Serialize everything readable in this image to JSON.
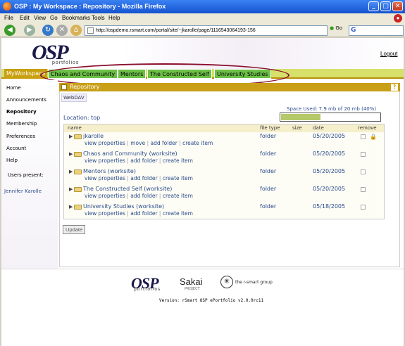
{
  "window": {
    "title": "OSP : My Workspace : Repository - Mozilla Firefox"
  },
  "menu": [
    "File",
    "Edit",
    "View",
    "Go",
    "Bookmarks",
    "Tools",
    "Help"
  ],
  "nav": {
    "url": "http://ospdemo.rsmart.com/portal/site/~jkarolle/page/1116543064193-156",
    "go_label": "Go",
    "search_value": ""
  },
  "header": {
    "logo": "OSP",
    "logo_sub": "portfolios",
    "logout": "Logout"
  },
  "tabs": [
    {
      "label": "MyWorkspace"
    },
    {
      "label": "Chaos and Community"
    },
    {
      "label": "Mentors"
    },
    {
      "label": "The Constructed Self"
    },
    {
      "label": "University Studies"
    }
  ],
  "sidebar": {
    "items": [
      {
        "label": "Home"
      },
      {
        "label": "Announcements"
      },
      {
        "label": "Repository"
      },
      {
        "label": "Membership"
      },
      {
        "label": "Preferences"
      },
      {
        "label": "Account"
      },
      {
        "label": "Help"
      },
      {
        "label": "Users present:"
      }
    ],
    "user": "Jennifer Karolle"
  },
  "tool": {
    "title": "Repository",
    "help": "?",
    "webdav": "WebDAV",
    "space_used": "Space Used: 7.9 mb of 20 mb  (40%)",
    "space_fraction": 0.4,
    "location_label": "Location:",
    "location_link": "top",
    "columns": {
      "name": "name",
      "type": "file type",
      "size": "size",
      "date": "date",
      "remove": "remove"
    },
    "rows": [
      {
        "name": "jkarolle",
        "actions": [
          "view properties",
          "move",
          "add folder",
          "create item"
        ],
        "type": "folder",
        "date": "05/20/2005",
        "lock": true
      },
      {
        "name": "Chaos and Community (worksite)",
        "actions": [
          "view properties",
          "add folder",
          "create item"
        ],
        "type": "folder",
        "date": "05/20/2005",
        "lock": false
      },
      {
        "name": "Mentors (worksite)",
        "actions": [
          "view properties",
          "add folder",
          "create item"
        ],
        "type": "folder",
        "date": "05/20/2005",
        "lock": false
      },
      {
        "name": "The Constructed Self (worksite)",
        "actions": [
          "view properties",
          "add folder",
          "create item"
        ],
        "type": "folder",
        "date": "05/20/2005",
        "lock": false
      },
      {
        "name": "University Studies (worksite)",
        "actions": [
          "view properties",
          "add folder",
          "create item"
        ],
        "type": "folder",
        "date": "05/18/2005",
        "lock": false
      }
    ],
    "update_label": "Update"
  },
  "footer": {
    "osp": "OSP",
    "osp_sub": "portfolios",
    "sakai": "Sakai",
    "sakai_sub": "PROJECT",
    "rsmart": "the r-smart group",
    "version": "Version: rSmart OSP ePortfolio v2.0.0rc11"
  },
  "colors": {
    "tab_selected": "#c8a010",
    "tab_normal": "#6cc046",
    "tool_header": "#c99f17",
    "highlight_oval": "#8b0f2f",
    "link": "#2a4a8a"
  }
}
